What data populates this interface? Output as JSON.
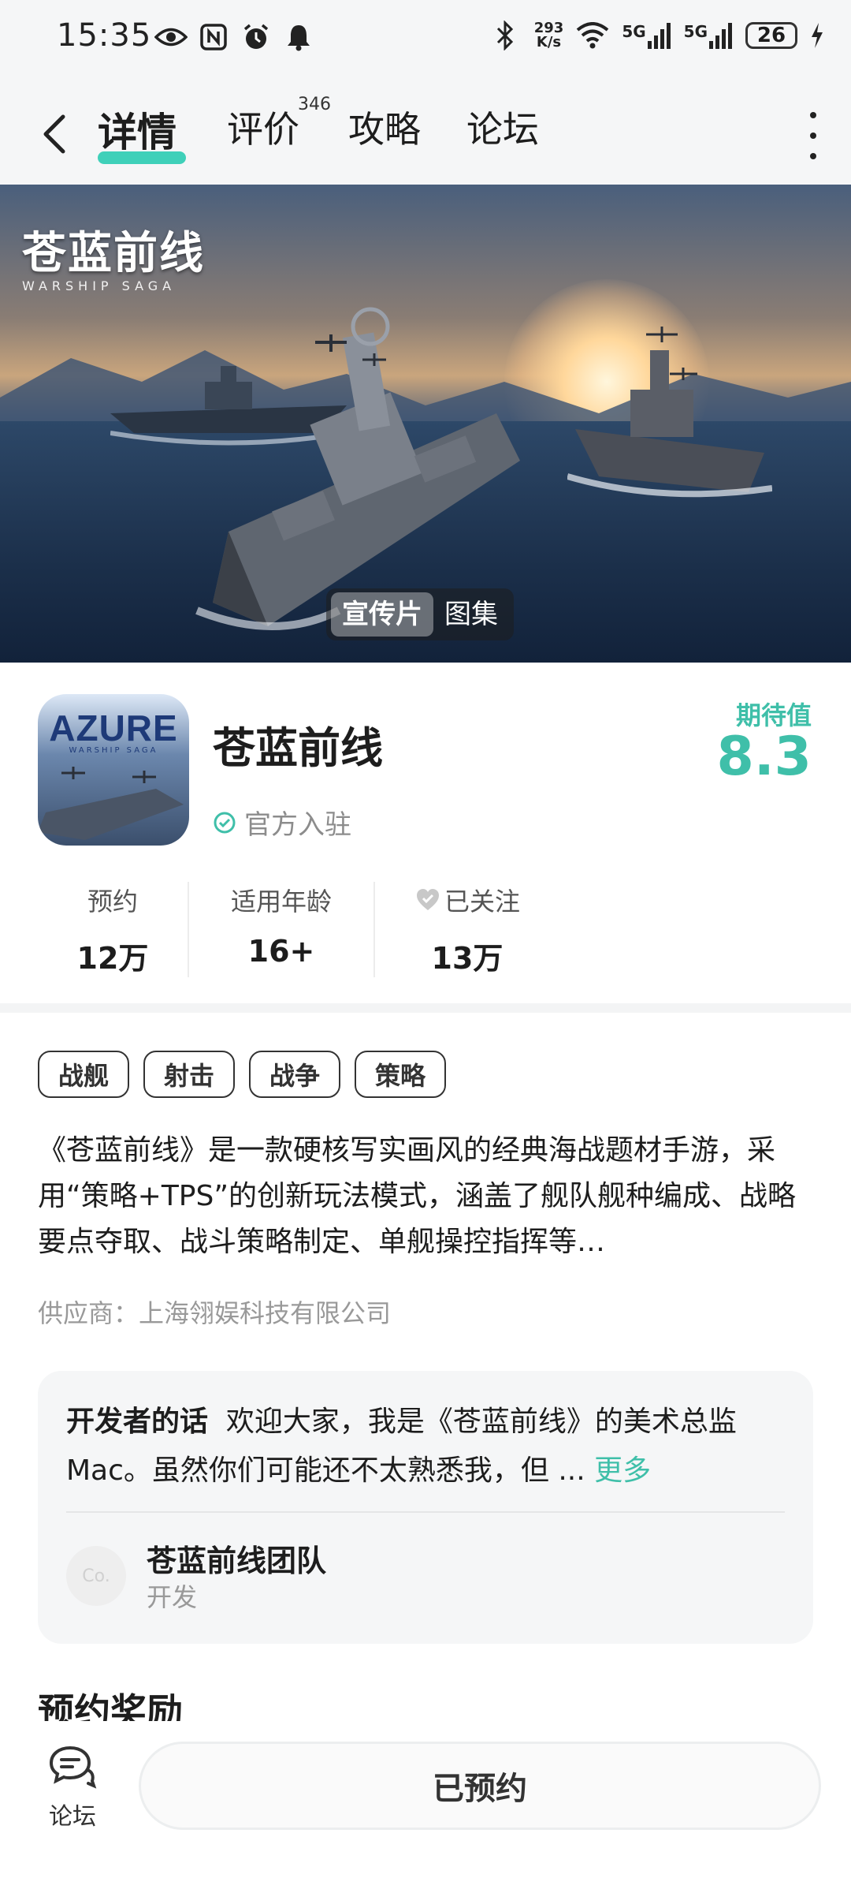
{
  "status_bar": {
    "time": "15:35",
    "net_speed_value": "293",
    "net_speed_unit": "K/s",
    "signal1": "5G",
    "signal2": "5G",
    "battery": "26"
  },
  "nav": {
    "tabs": [
      {
        "label": "详情"
      },
      {
        "label": "评价",
        "badge": "346"
      },
      {
        "label": "攻略"
      },
      {
        "label": "论坛"
      }
    ]
  },
  "banner": {
    "logo_cn": "苍蓝前线",
    "logo_en": "WARSHIP SAGA",
    "media_tabs": [
      "宣传片",
      "图集"
    ]
  },
  "game": {
    "icon_title": "AZURE",
    "icon_subtitle": "WARSHIP SAGA",
    "title": "苍蓝前线",
    "official_label": "官方入驻",
    "expect_label": "期待值",
    "expect_value": "8.3",
    "stats": [
      {
        "label": "预约",
        "value": "12万"
      },
      {
        "label": "适用年龄",
        "value": "16+"
      },
      {
        "label": "已关注",
        "value": "13万"
      }
    ],
    "tags": [
      "战舰",
      "射击",
      "战争",
      "策略"
    ],
    "description": "《苍蓝前线》是一款硬核写实画风的经典海战题材手游，采用“策略+TPS”的创新玩法模式，涵盖了舰队舰种编成、战略要点夺取、战斗策略制定、单舰操控指挥等…",
    "supplier": "供应商：上海翎娱科技有限公司"
  },
  "developer": {
    "heading": "开发者的话",
    "text": "欢迎大家，我是《苍蓝前线》的美术总监Mac。虽然你们可能还不太熟悉我，但 ...",
    "more": "更多",
    "avatar_text": "Co.",
    "team_name": "苍蓝前线团队",
    "team_role": "开发"
  },
  "section": {
    "title": "预约奖励"
  },
  "bottom": {
    "forum_label": "论坛",
    "reserve_label": "已预约"
  },
  "colors": {
    "accent": "#3fbfa9",
    "tab_underline": "#3fd0b9",
    "bar_bg": "#f5f6f7"
  }
}
